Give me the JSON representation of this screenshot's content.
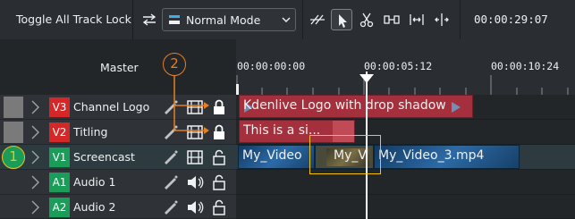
{
  "toolbar": {
    "toggle_lock_label": "Toggle All Track Lock",
    "mode_label": "Normal Mode",
    "timecode": "00:00:29:07",
    "tools": [
      "razor-spacer-icon",
      "select-pointer-icon",
      "razor-cut-icon",
      "spacer-icon",
      "ripple-icon",
      "slip-icon",
      "multicam-icon"
    ]
  },
  "header": {
    "master_label": "Master",
    "badge_1": "1",
    "badge_2": "2"
  },
  "ruler": {
    "labels": [
      "00:00:00:00",
      "00:00:05:12",
      "00:00:10:24"
    ]
  },
  "tracks": [
    {
      "tag": "V3",
      "name": "Channel Logo",
      "type": "video",
      "locked": true
    },
    {
      "tag": "V2",
      "name": "Titling",
      "type": "video",
      "locked": true
    },
    {
      "tag": "V1",
      "name": "Screencast",
      "type": "video",
      "locked": false
    },
    {
      "tag": "A1",
      "name": "Audio 1",
      "type": "audio",
      "locked": false
    },
    {
      "tag": "A2",
      "name": "Audio 2",
      "type": "audio",
      "locked": false
    }
  ],
  "clips": {
    "v3_title": "Kdenlive Logo with drop shadow",
    "v2_title": "This is a si...",
    "v1_clip_a": "My_Video",
    "v1_clip_b": "My_V",
    "v1_clip_c": "My_Video_3.mp4"
  },
  "colors": {
    "video_tag": "#d42828",
    "audio_tag": "#1c9c59",
    "title_clip": "#a3303c",
    "video_clip": "#1c4f7d",
    "badge": "#e67e22",
    "highlight": "#f1c40f"
  }
}
